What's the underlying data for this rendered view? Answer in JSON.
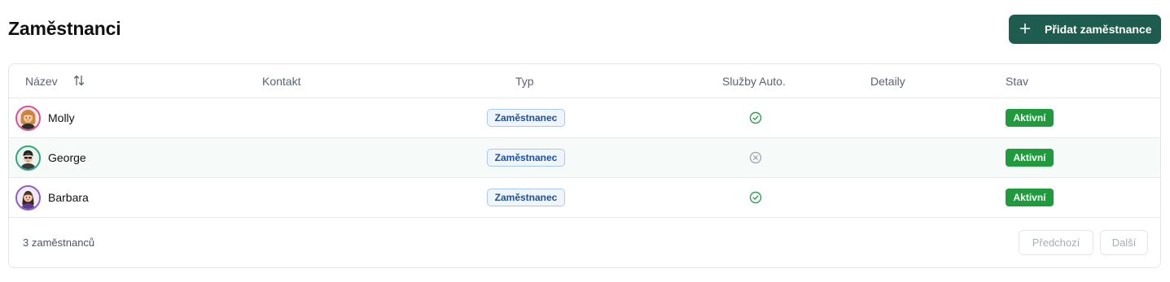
{
  "page": {
    "title": "Zaměstnanci"
  },
  "actions": {
    "add_label": "Přidat zaměstnance"
  },
  "table": {
    "columns": {
      "name": "Název",
      "contact": "Kontakt",
      "type": "Typ",
      "services": "Služby Auto.",
      "details": "Detaily",
      "status": "Stav"
    },
    "rows": [
      {
        "name": "Molly",
        "contact": "",
        "type": "Zaměstnanec",
        "services_auto": "enabled",
        "details": "",
        "status": "Aktivní",
        "avatar_ring": "#d9508c"
      },
      {
        "name": "George",
        "contact": "",
        "type": "Zaměstnanec",
        "services_auto": "disabled",
        "details": "",
        "status": "Aktivní",
        "avatar_ring": "#2fa37a"
      },
      {
        "name": "Barbara",
        "contact": "",
        "type": "Zaměstnanec",
        "services_auto": "enabled",
        "details": "",
        "status": "Aktivní",
        "avatar_ring": "#8b5cc4"
      }
    ]
  },
  "footer": {
    "count_text": "3 zaměstnanců",
    "prev_label": "Předchozí",
    "next_label": "Další"
  },
  "colors": {
    "primary": "#1d5c4f",
    "active_badge": "#1f9a3d",
    "type_badge_text": "#1e4f9a",
    "check_green": "#2e9e4f",
    "x_gray": "#9ca3af"
  },
  "icons": {
    "add": "plus-icon",
    "sort": "sort-arrows-icon",
    "services_enabled": "check-circle-icon",
    "services_disabled": "x-circle-icon"
  }
}
